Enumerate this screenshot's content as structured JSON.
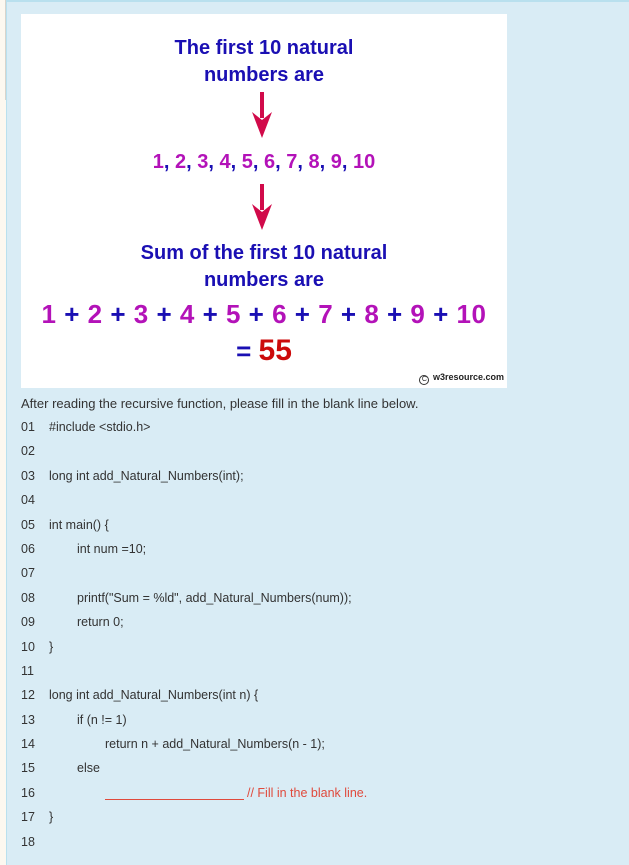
{
  "figure": {
    "heading1_line1": "The first 10 natural",
    "heading1_line2": "numbers are",
    "sequence": [
      "1",
      "2",
      "3",
      "4",
      "5",
      "6",
      "7",
      "8",
      "9",
      "10"
    ],
    "sequence_separator": ", ",
    "heading2_line1": "Sum of the first 10 natural",
    "heading2_line2": "numbers are",
    "sum_terms": [
      "1",
      "2",
      "3",
      "4",
      "5",
      "6",
      "7",
      "8",
      "9",
      "10"
    ],
    "sum_operator": " + ",
    "equals": "= ",
    "result": "55",
    "copyright_symbol": "C",
    "copyright_text": "w3resource.com",
    "colors": {
      "heading": "#1a0fb3",
      "numbers": "#b312b8",
      "arrow": "#d10a4a",
      "result": "#cc0a0a"
    }
  },
  "instruction": "After reading the recursive function, please fill in the blank line below.",
  "code_lines": [
    {
      "num": "01",
      "indent": 0,
      "text": "#include <stdio.h>"
    },
    {
      "num": "02",
      "indent": 0,
      "text": ""
    },
    {
      "num": "03",
      "indent": 0,
      "text": "long int add_Natural_Numbers(int);"
    },
    {
      "num": "04",
      "indent": 0,
      "text": ""
    },
    {
      "num": "05",
      "indent": 0,
      "text": "int main() {"
    },
    {
      "num": "06",
      "indent": 1,
      "text": "int num =10;"
    },
    {
      "num": "07",
      "indent": 0,
      "text": ""
    },
    {
      "num": "08",
      "indent": 1,
      "text": "printf(\"Sum = %ld\", add_Natural_Numbers(num));"
    },
    {
      "num": "09",
      "indent": 1,
      "text": "return 0;"
    },
    {
      "num": "10",
      "indent": 0,
      "text": "}"
    },
    {
      "num": "11",
      "indent": 0,
      "text": ""
    },
    {
      "num": "12",
      "indent": 0,
      "text": "long int add_Natural_Numbers(int n) {"
    },
    {
      "num": "13",
      "indent": 1,
      "text": "if (n != 1)"
    },
    {
      "num": "14",
      "indent": 2,
      "text": "return n + add_Natural_Numbers(n - 1);"
    },
    {
      "num": "15",
      "indent": 1,
      "text": "else"
    },
    {
      "num": "16",
      "indent": 2,
      "text": "",
      "blank": true,
      "comment": "// Fill in the blank line."
    },
    {
      "num": "17",
      "indent": 0,
      "text": "}"
    },
    {
      "num": "18",
      "indent": 0,
      "text": ""
    }
  ]
}
